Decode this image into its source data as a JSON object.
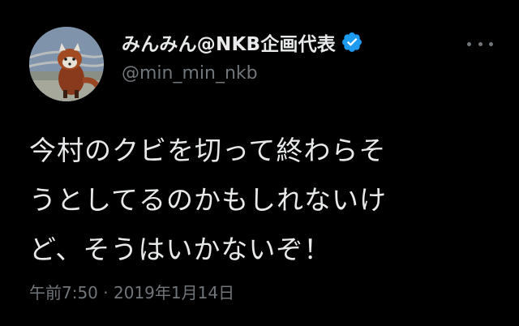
{
  "author": {
    "display_name": "みんみん@NKB企画代表",
    "handle": "@min_min_nkb",
    "verified": true,
    "avatar_icon": "red-panda-avatar-icon"
  },
  "tweet": {
    "text": "今村のクビを切って終わらそ\nうとしてるのかもしれないけ\nど、そうはいかないぞ！"
  },
  "meta": {
    "time": "午前7:50",
    "separator": " · ",
    "date": "2019年1月14日"
  },
  "colors": {
    "background": "#000000",
    "text_primary": "#e7e9ea",
    "text_secondary": "#71767b",
    "verified_blue": "#1d9bf0"
  },
  "icons": {
    "verified": "verified-badge-icon",
    "more": "more-options-icon"
  }
}
